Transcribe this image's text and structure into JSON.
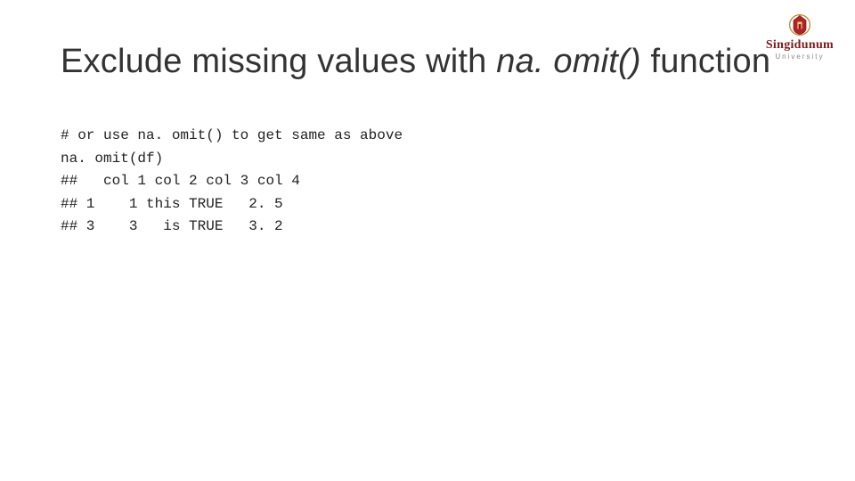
{
  "title": {
    "pre": "Exclude missing values with ",
    "fn": "na. omit()",
    "post": " function"
  },
  "code": {
    "l1": "# or use na. omit() to get same as above",
    "l2": "na. omit(df)",
    "l3": "##   col 1 col 2 col 3 col 4",
    "l4": "## 1    1 this TRUE   2. 5",
    "l5": "## 3    3   is TRUE   3. 2"
  },
  "logo": {
    "name": "Singidunum",
    "sub": "University"
  }
}
